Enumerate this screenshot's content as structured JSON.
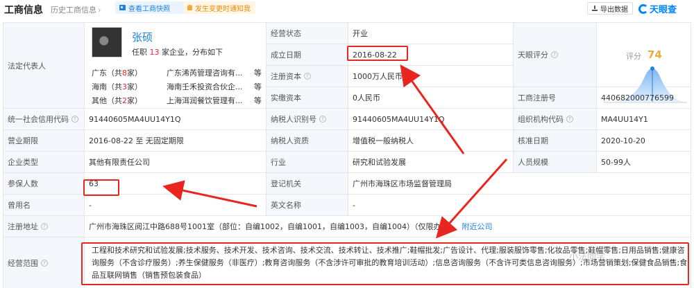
{
  "header": {
    "title": "工商信息",
    "history": "历史工商信息",
    "snapshot_btn": "查看工商快照",
    "notify_btn": "发生变更时通知我",
    "export_btn": "导出数据",
    "logo": "天眼查"
  },
  "legal_rep": {
    "label": "法定代表人",
    "name": "张硕",
    "summary_prefix": "任职",
    "summary_count": "13",
    "summary_suffix": "家企业，分布如下",
    "regions": [
      {
        "region": "广东（共",
        "count": "8",
        "unit": "家）",
        "company": "广东浠芮管理咨询有...",
        "more": "等"
      },
      {
        "region": "海南（共",
        "count": "3",
        "unit": "家）",
        "company": "海南壬禾投资合伙企...",
        "more": "等"
      },
      {
        "region": "其他（共",
        "count": "2",
        "unit": "家）",
        "company": "上海洱润餐饮管理有...",
        "more": "等"
      }
    ]
  },
  "score": {
    "label": "天眼评分",
    "title": "评分",
    "value": "74"
  },
  "fields": {
    "status_label": "经营状态",
    "status": "开业",
    "founded_label": "成立日期",
    "founded": "2016-08-22",
    "capital_label": "注册资本",
    "capital": "1000万人民币",
    "paid_label": "实缴资本",
    "paid": "0人民币",
    "regno_label": "工商注册号",
    "regno": "440682000776599",
    "credit_label": "统一社会信用代码",
    "credit": "91440605MA4UU14Y1Q",
    "taxid_label": "纳税人识别号",
    "taxid": "91440605MA4UU14Y1Q",
    "orgcode_label": "组织机构代码",
    "orgcode": "MA4UU14Y1",
    "term_label": "营业期限",
    "term": "2016-08-22  至  无固定期限",
    "taxqual_label": "纳税人资质",
    "taxqual": "增值税一般纳税人",
    "approve_label": "核准日期",
    "approve": "2020-10-20",
    "type_label": "企业类型",
    "type": "其他有限责任公司",
    "industry_label": "行业",
    "industry": "研究和试验发展",
    "staff_label": "人员规模",
    "staff": "50-99人",
    "insured_label": "参保人数",
    "insured": "63",
    "authority_label": "登记机关",
    "authority": "广州市海珠区市场监督管理局",
    "former_label": "曾用名",
    "former": "-",
    "english_label": "英文名称",
    "english": "-",
    "address_label": "注册地址",
    "address": "广州市海珠区阅江中路688号1001室（部位：自编1002，自编1001，自编1003，自编1004）（仅限办公）",
    "nearby": "附近公司",
    "scope_label": "经营范围",
    "scope": "工程和技术研究和试验发展;技术服务、技术开发、技术咨询、技术交流、技术转让、技术推广;鞋帽批发;广告设计、代理;服装服饰零售;化妆品零售;鞋帽零售;日用品销售;健康咨询服务（不含诊疗服务）;养生保健服务（非医疗）;教育咨询服务（不含涉许可审批的教育培训活动）;信息咨询服务（不含许可类信息咨询服务）;市场营销策划;保健食品销售;食品互联网销售（销售预包装食品）"
  },
  "watermark": "小法同学",
  "colors": {
    "accent": "#1f81e0",
    "label_bg": "#f4f8fd",
    "annotation": "#e8251f",
    "score": "#f2a93b"
  }
}
